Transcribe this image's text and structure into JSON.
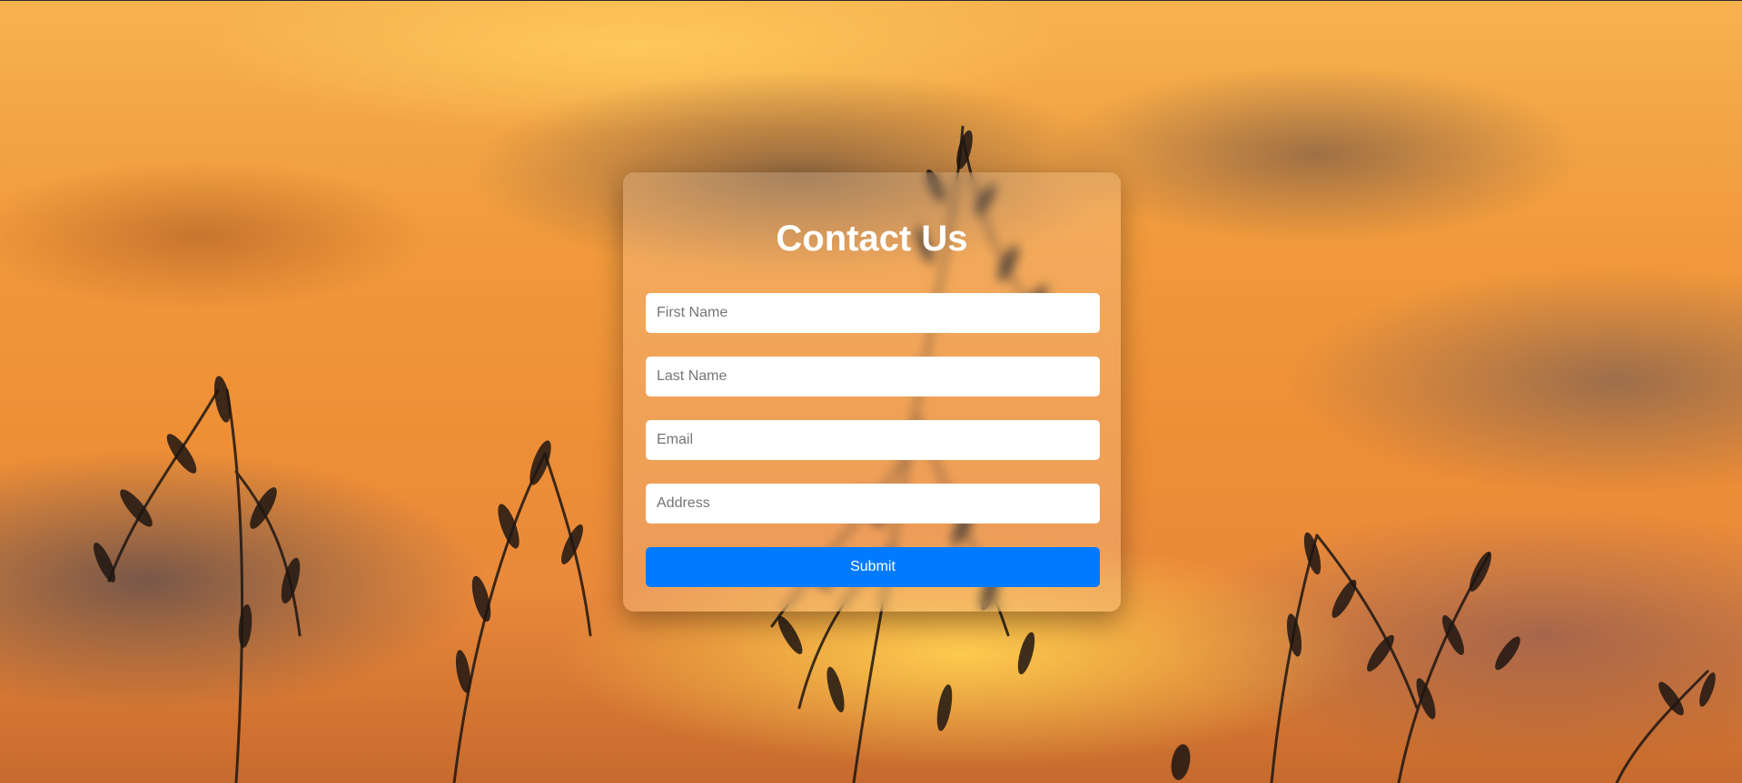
{
  "form": {
    "title": "Contact Us",
    "first_name_placeholder": "First Name",
    "last_name_placeholder": "Last Name",
    "email_placeholder": "Email",
    "address_placeholder": "Address",
    "submit_label": "Submit"
  },
  "colors": {
    "submit_button": "#007bff",
    "title_text": "#ffffff",
    "card_background": "rgba(255,255,255,0.16)"
  },
  "background": {
    "description_icon": "sunset-grass-photo"
  }
}
